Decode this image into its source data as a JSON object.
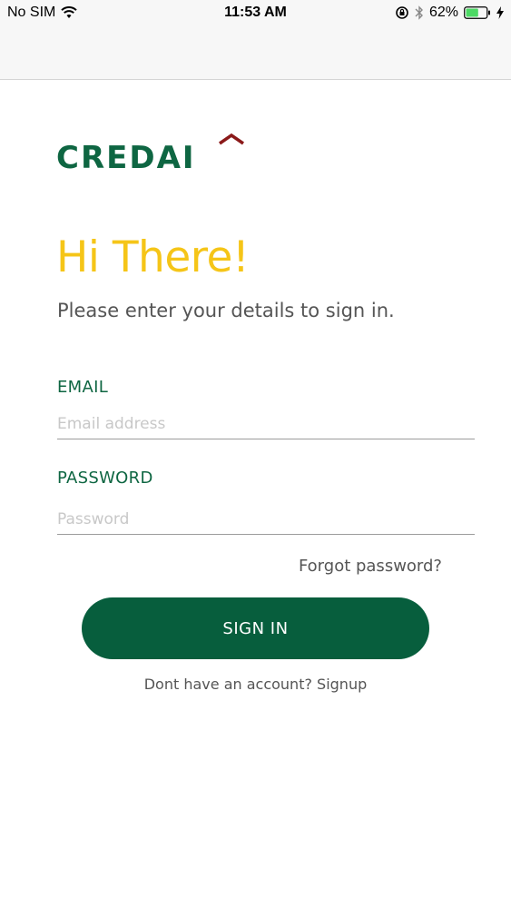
{
  "status_bar": {
    "carrier": "No SIM",
    "time": "11:53 AM",
    "battery_percent": "62%",
    "battery_level": 0.62,
    "icons": [
      "wifi-icon",
      "orientation-lock-icon",
      "bluetooth-icon",
      "battery-icon",
      "charging-bolt-icon"
    ]
  },
  "brand": {
    "logo_text": "CREDAI",
    "primary_color": "#0e6642",
    "accent_color": "#8b1a1a"
  },
  "greeting": {
    "title": "Hi There!",
    "subtitle": "Please enter your details to sign in.",
    "title_color": "#f5c518"
  },
  "form": {
    "email_label": "EMAIL",
    "email_placeholder": "Email address",
    "email_value": "",
    "password_label": "PASSWORD",
    "password_placeholder": "Password",
    "password_value": "",
    "forgot_label": "Forgot password?",
    "signin_label": "SIGN IN"
  },
  "footer": {
    "prompt": "Dont have an account? ",
    "signup_label": "Signup"
  }
}
